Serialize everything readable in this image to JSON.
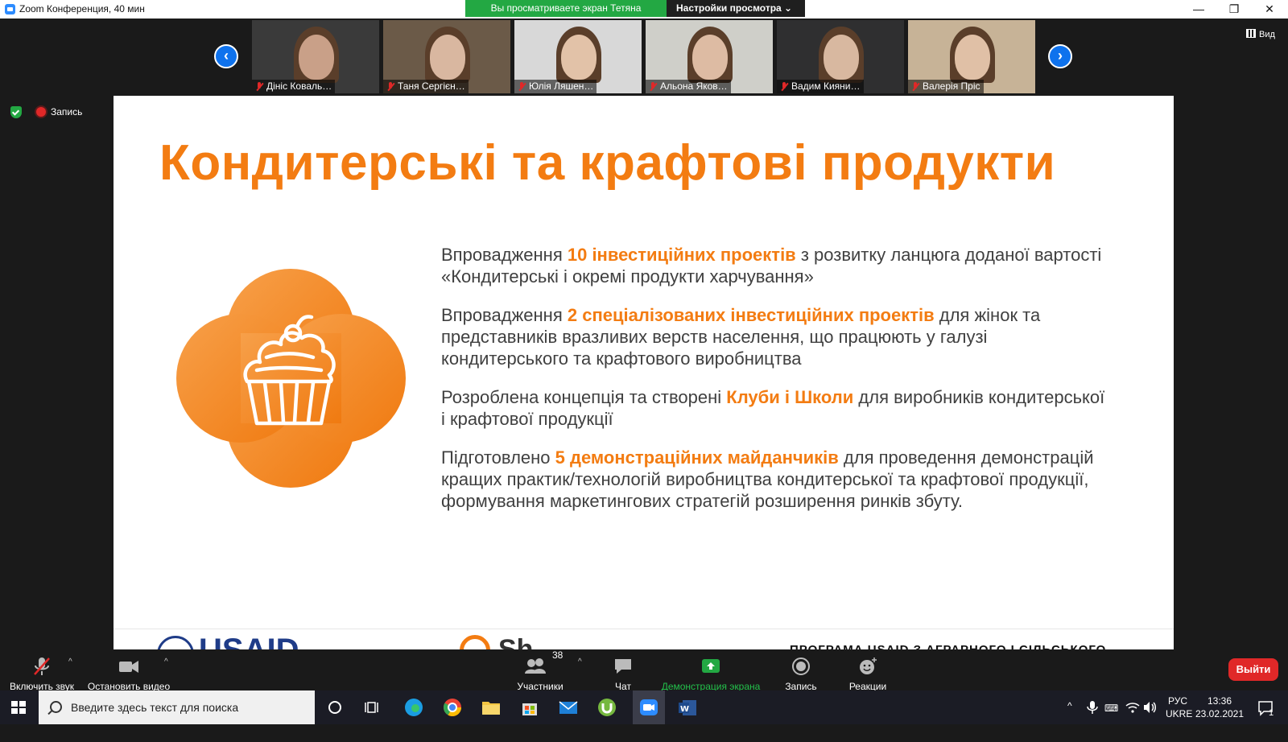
{
  "window": {
    "title": "Zoom Конференция, 40 мин",
    "share_banner": "Вы просматриваете экран Тетяна Монке",
    "view_settings": "Настройки просмотра ⌄",
    "minimize": "—",
    "restore": "❐",
    "close": "✕"
  },
  "nav": {
    "prev": "‹",
    "next": "›"
  },
  "participants": [
    {
      "name": "Дініс Коваль…",
      "bg": "#3a3a3a",
      "skin": "#c9a088"
    },
    {
      "name": "Таня Сергієн…",
      "bg": "#6b5a48",
      "skin": "#d9b7a0"
    },
    {
      "name": "Юлія Ляшен…",
      "bg": "#d8d8d8",
      "skin": "#e2c2a8"
    },
    {
      "name": "Альона Яков…",
      "bg": "#cfcfc9",
      "skin": "#ddbba3"
    },
    {
      "name": "Вадим Кияни…",
      "bg": "#2f2f30",
      "skin": "#d8b8a0"
    },
    {
      "name": "Валерія Пріс",
      "bg": "#c7b397",
      "skin": "#e0c0a6"
    }
  ],
  "view_button": "Вид",
  "recording_indicator": "Запись",
  "slide": {
    "title": "Кондитерські та крафтові продукти",
    "bullets": [
      {
        "pre": "Впровадження ",
        "hl": "10 інвестиційних проектів",
        "post": " з розвитку ланцюга доданої вартості «Кондитерські і окремі продукти харчування»"
      },
      {
        "pre": "Впровадження ",
        "hl": "2 спеціалізованих інвестиційних проектів",
        "post": " для жінок та представників вразливих верств населення, що працюють у галузі кондитерського та крафтового виробництва"
      },
      {
        "pre": "Розроблена концепція та створені ",
        "hl": "Клуби і Школи",
        "post": " для виробників кондитерської і крафтової продукції"
      },
      {
        "pre": "Підготовлено ",
        "hl": "5 демонстраційних майданчиків",
        "post": " для проведення демонстрацій кращих практик/технологій виробництва кондитерської та крафтової продукції, формування маркетингових стратегій розширення ринків збуту."
      }
    ],
    "footer_left": "USAID",
    "footer_mid": "Sh",
    "footer_right": "ПРОГРАМА USAID З АГРАРНОГО І СІЛЬСЬКОГО"
  },
  "toolbar": {
    "unmute": "Включить звук",
    "stop_video": "Остановить видео",
    "participants": "Участники",
    "participants_count": "38",
    "chat": "Чат",
    "share": "Демонстрация экрана",
    "record": "Запись",
    "reactions": "Реакции",
    "leave": "Выйти"
  },
  "taskbar": {
    "search_placeholder": "Введите здесь текст для поиска",
    "lang_top": "РУС",
    "lang_bottom": "UKRE",
    "time": "13:36",
    "date": "23.02.2021",
    "notifications": "1"
  },
  "colors": {
    "accent": "#f37c12",
    "zoom_blue": "#0e72ed",
    "share_green": "#23a843",
    "leave_red": "#e02828"
  }
}
